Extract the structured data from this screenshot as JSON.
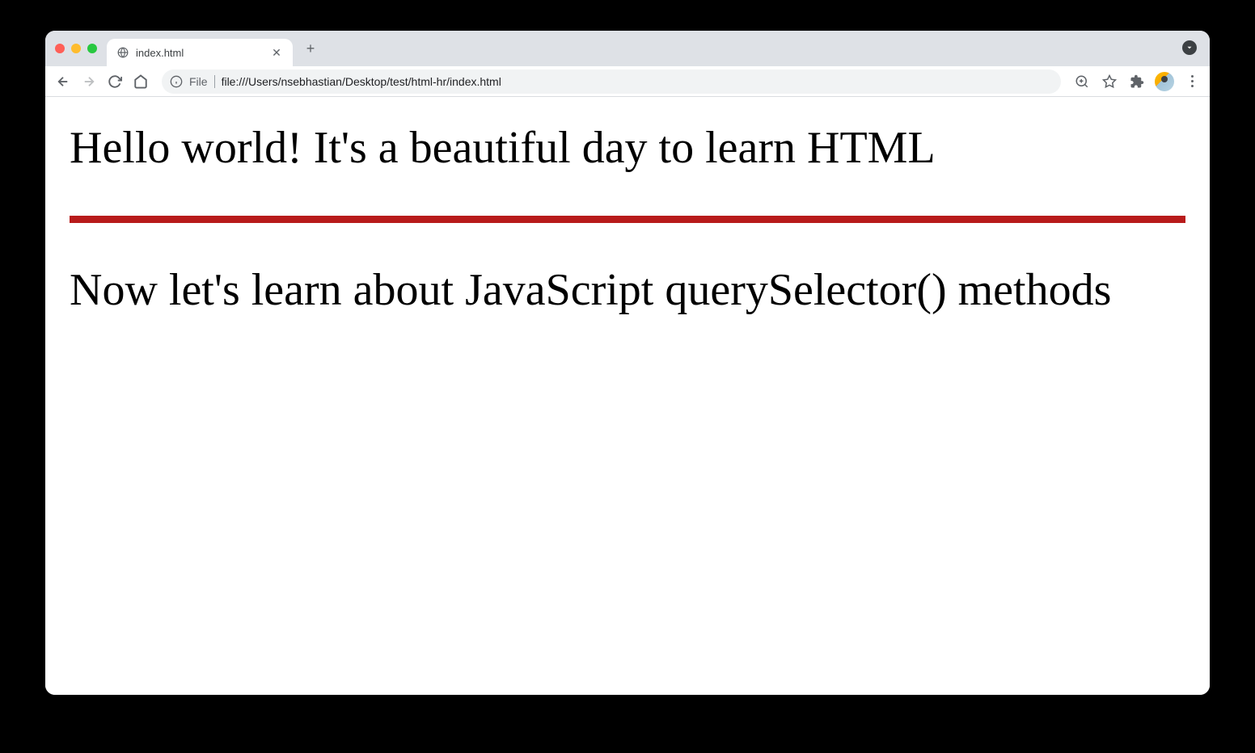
{
  "window": {
    "tab": {
      "title": "index.html"
    },
    "address": {
      "scheme": "File",
      "url": "file:///Users/nsebhastian/Desktop/test/html-hr/index.html"
    }
  },
  "page": {
    "heading1": "Hello world! It's a beautiful day to learn HTML",
    "heading2": "Now let's learn about JavaScript querySelector() methods"
  },
  "colors": {
    "hr": "#b81b1b"
  }
}
